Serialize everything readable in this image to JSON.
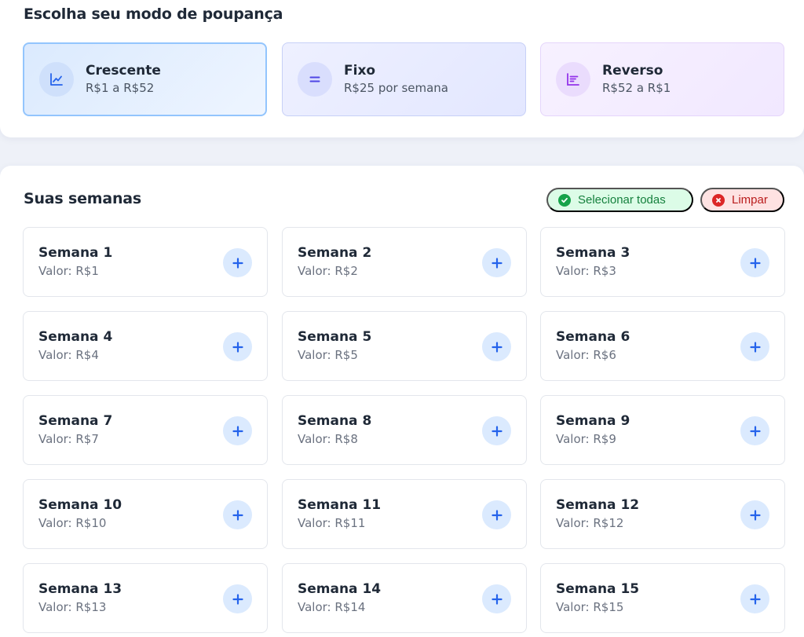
{
  "modes": {
    "title": "Escolha seu modo de poupança",
    "cards": [
      {
        "name": "Crescente",
        "sub": "R$1 a R$52",
        "icon": "chart-line-icon"
      },
      {
        "name": "Fixo",
        "sub": "R$25 por semana",
        "icon": "equals-icon"
      },
      {
        "name": "Reverso",
        "sub": "R$52 a R$1",
        "icon": "bars-descending-icon"
      }
    ],
    "selected": "Crescente"
  },
  "weeks": {
    "title": "Suas semanas",
    "select_all_label": "Selecionar todas",
    "clear_label": "Limpar",
    "items": [
      {
        "name": "Semana 1",
        "value": "Valor: R$1"
      },
      {
        "name": "Semana 2",
        "value": "Valor: R$2"
      },
      {
        "name": "Semana 3",
        "value": "Valor: R$3"
      },
      {
        "name": "Semana 4",
        "value": "Valor: R$4"
      },
      {
        "name": "Semana 5",
        "value": "Valor: R$5"
      },
      {
        "name": "Semana 6",
        "value": "Valor: R$6"
      },
      {
        "name": "Semana 7",
        "value": "Valor: R$7"
      },
      {
        "name": "Semana 8",
        "value": "Valor: R$8"
      },
      {
        "name": "Semana 9",
        "value": "Valor: R$9"
      },
      {
        "name": "Semana 10",
        "value": "Valor: R$10"
      },
      {
        "name": "Semana 11",
        "value": "Valor: R$11"
      },
      {
        "name": "Semana 12",
        "value": "Valor: R$12"
      },
      {
        "name": "Semana 13",
        "value": "Valor: R$13"
      },
      {
        "name": "Semana 14",
        "value": "Valor: R$14"
      },
      {
        "name": "Semana 15",
        "value": "Valor: R$15"
      }
    ]
  },
  "colors": {
    "accent": "#2563eb",
    "success": "#16a34a",
    "danger": "#dc2626",
    "page_background": "#eef1f8"
  }
}
